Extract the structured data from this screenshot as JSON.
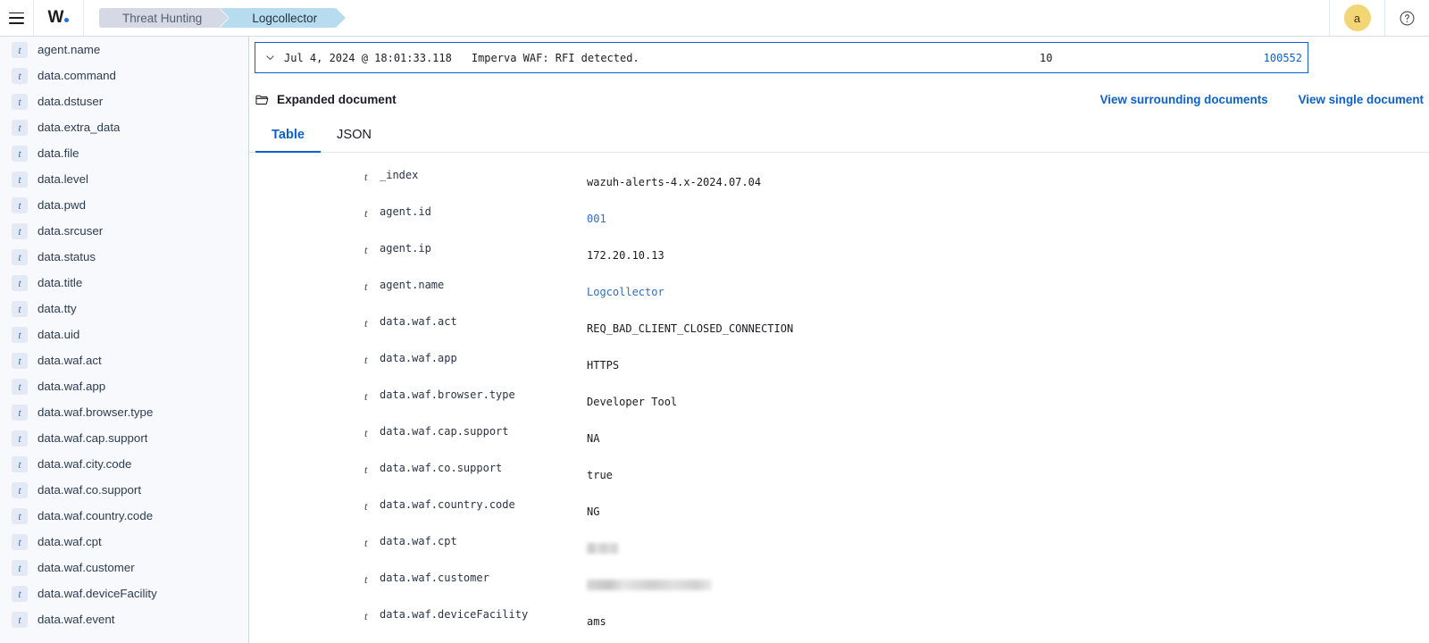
{
  "topbar": {
    "menu_icon": "hamburger-menu-icon",
    "logo_text": "W",
    "logo_dot": "blue-dot",
    "breadcrumbs": [
      {
        "label": "Threat Hunting",
        "active": false
      },
      {
        "label": "Logcollector",
        "active": true
      }
    ],
    "avatar_initial": "a",
    "help_icon": "question-mark-circle-icon",
    "accent_color": "#0b61cf",
    "avatar_color": "#f2d675",
    "crumb_inactive_color": "#d4d9e5",
    "crumb_active_color": "#b7dcf0"
  },
  "sidebar": {
    "fields": [
      {
        "type": "t",
        "name": "agent.name"
      },
      {
        "type": "t",
        "name": "data.command"
      },
      {
        "type": "t",
        "name": "data.dstuser"
      },
      {
        "type": "t",
        "name": "data.extra_data"
      },
      {
        "type": "t",
        "name": "data.file"
      },
      {
        "type": "t",
        "name": "data.level"
      },
      {
        "type": "t",
        "name": "data.pwd"
      },
      {
        "type": "t",
        "name": "data.srcuser"
      },
      {
        "type": "t",
        "name": "data.status"
      },
      {
        "type": "t",
        "name": "data.title"
      },
      {
        "type": "t",
        "name": "data.tty"
      },
      {
        "type": "t",
        "name": "data.uid"
      },
      {
        "type": "t",
        "name": "data.waf.act"
      },
      {
        "type": "t",
        "name": "data.waf.app"
      },
      {
        "type": "t",
        "name": "data.waf.browser.type"
      },
      {
        "type": "t",
        "name": "data.waf.cap.support"
      },
      {
        "type": "t",
        "name": "data.waf.city.code"
      },
      {
        "type": "t",
        "name": "data.waf.co.support"
      },
      {
        "type": "t",
        "name": "data.waf.country.code"
      },
      {
        "type": "t",
        "name": "data.waf.cpt"
      },
      {
        "type": "t",
        "name": "data.waf.customer"
      },
      {
        "type": "t",
        "name": "data.waf.deviceFacility"
      },
      {
        "type": "t",
        "name": "data.waf.event"
      }
    ]
  },
  "main": {
    "doc_row": {
      "caret_icon": "chevron-down-icon",
      "timestamp": "Jul 4, 2024 @ 18:01:33.118",
      "message": "Imperva WAF: RFI detected.",
      "level": "10",
      "id": "100552"
    },
    "expanded": {
      "folder_icon": "folder-open-icon",
      "title": "Expanded document",
      "link_surrounding": "View surrounding documents",
      "link_single": "View single document"
    },
    "tabs": [
      {
        "label": "Table",
        "active": true
      },
      {
        "label": "JSON",
        "active": false
      }
    ],
    "rows": [
      {
        "t": "t",
        "key": "_index",
        "value": "wazuh-alerts-4.x-2024.07.04",
        "style": "plain"
      },
      {
        "t": "t",
        "key": "agent.id",
        "value": "001",
        "style": "link"
      },
      {
        "t": "t",
        "key": "agent.ip",
        "value": "172.20.10.13",
        "style": "plain"
      },
      {
        "t": "t",
        "key": "agent.name",
        "value": "Logcollector",
        "style": "link"
      },
      {
        "t": "t",
        "key": "data.waf.act",
        "value": "REQ_BAD_CLIENT_CLOSED_CONNECTION",
        "style": "plain"
      },
      {
        "t": "t",
        "key": "data.waf.app",
        "value": "HTTPS",
        "style": "plain"
      },
      {
        "t": "t",
        "key": "data.waf.browser.type",
        "value": "Developer Tool",
        "style": "plain"
      },
      {
        "t": "t",
        "key": "data.waf.cap.support",
        "value": "NA",
        "style": "plain"
      },
      {
        "t": "t",
        "key": "data.waf.co.support",
        "value": "true",
        "style": "plain"
      },
      {
        "t": "t",
        "key": "data.waf.country.code",
        "value": "NG",
        "style": "plain"
      },
      {
        "t": "t",
        "key": "data.waf.cpt",
        "value": "",
        "style": "redact",
        "redact_width": 36
      },
      {
        "t": "t",
        "key": "data.waf.customer",
        "value": "",
        "style": "redact",
        "redact_width": 140
      },
      {
        "t": "t",
        "key": "data.waf.deviceFacility",
        "value": "ams",
        "style": "plain"
      }
    ]
  }
}
